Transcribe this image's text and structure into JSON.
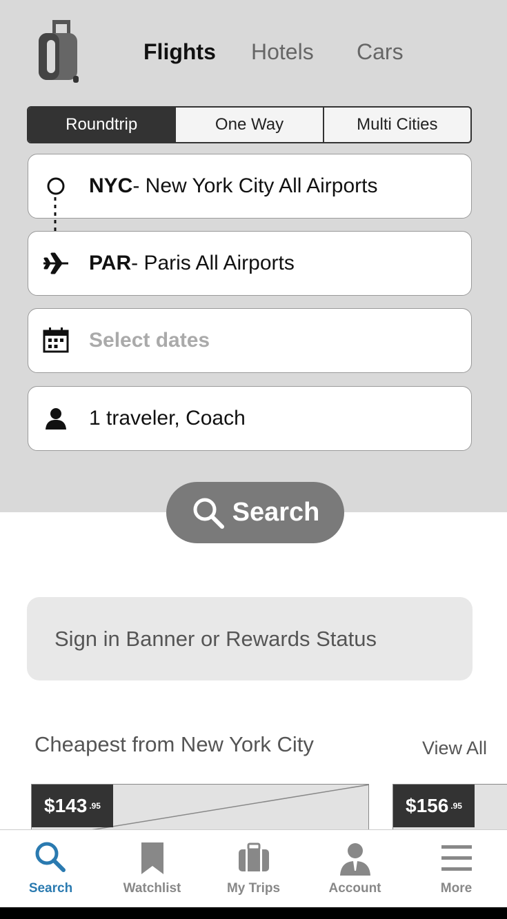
{
  "header": {
    "tabs": [
      {
        "label": "Flights",
        "active": true
      },
      {
        "label": "Hotels",
        "active": false
      },
      {
        "label": "Cars",
        "active": false
      }
    ]
  },
  "trip_type": {
    "options": [
      "Roundtrip",
      "One Way",
      "Multi Cities"
    ],
    "selected": "Roundtrip"
  },
  "origin": {
    "code": "NYC",
    "name": " - New York City All Airports",
    "icon": "origin-circle-icon"
  },
  "destination": {
    "code": "PAR",
    "name": " - Paris All Airports",
    "icon": "airplane-icon"
  },
  "dates": {
    "placeholder": "Select dates",
    "icon": "calendar-icon"
  },
  "travelers": {
    "value": "1 traveler, Coach",
    "icon": "person-icon"
  },
  "search_button": {
    "label": "Search",
    "icon": "search-icon"
  },
  "banner": {
    "text": "Sign in Banner or Rewards Status"
  },
  "deals": {
    "title": "Cheapest from New York City",
    "view_all": "View All",
    "cards": [
      {
        "price": "$143",
        "cents": ".95"
      },
      {
        "price": "$156",
        "cents": ".95"
      }
    ]
  },
  "bottom_nav": {
    "items": [
      {
        "label": "Search",
        "icon": "search-icon",
        "active": true
      },
      {
        "label": "Watchlist",
        "icon": "bookmark-icon",
        "active": false
      },
      {
        "label": "My Trips",
        "icon": "suitcase-icon",
        "active": false
      },
      {
        "label": "Account",
        "icon": "account-icon",
        "active": false
      },
      {
        "label": "More",
        "icon": "menu-icon",
        "active": false
      }
    ]
  },
  "colors": {
    "accent": "#2a7ab0",
    "panel": "#d9d9d9",
    "dark": "#333333"
  }
}
